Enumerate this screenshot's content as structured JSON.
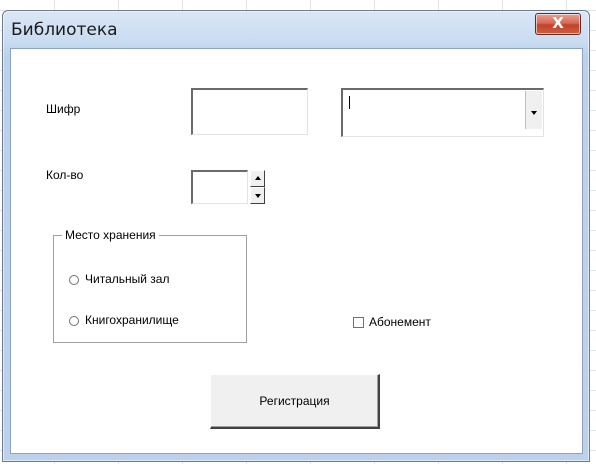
{
  "window": {
    "title": "Библиотека",
    "close_icon": "X"
  },
  "form": {
    "code_label": "Шифр",
    "code_value": "",
    "code_combo_value": "",
    "qty_label": "Кол-во",
    "qty_value": "",
    "storage_group": {
      "legend": "Место хранения",
      "options": [
        {
          "label": "Читальный зал",
          "selected": false
        },
        {
          "label": "Книгохранилище",
          "selected": false
        }
      ]
    },
    "subscription_label": "Абонемент",
    "subscription_checked": false,
    "register_button": "Регистрация"
  }
}
